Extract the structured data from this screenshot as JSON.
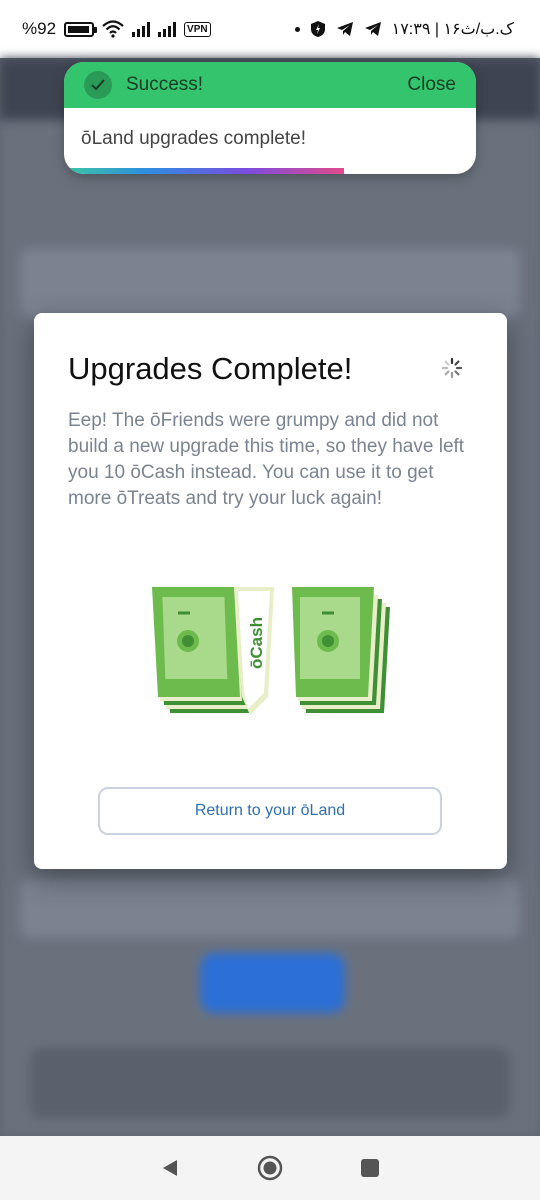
{
  "status_bar": {
    "battery_text": "%92",
    "time_text": "۱۷:۳۹ | ۱۶ک.ب/ث",
    "vpn_label": "VPN"
  },
  "toast": {
    "title": "Success!",
    "close_label": "Close",
    "message": "ōLand upgrades complete!",
    "progress": 0.68
  },
  "modal": {
    "title": "Upgrades Complete!",
    "body": "Eep! The ōFriends were grumpy and did not build a new upgrade this time, so they have left you 10 ōCash instead. You can use it to get more ōTreats and try your luck again!",
    "cash_label": "ōCash",
    "button_label": "Return to your ōLand"
  },
  "colors": {
    "success": "#35c46e",
    "cash_green": "#6dbb4c",
    "button_text": "#2f6fb0"
  },
  "icons": [
    "check-icon",
    "spinner-icon",
    "wifi-icon",
    "battery-icon",
    "back-icon",
    "home-icon",
    "recents-icon",
    "telegram-icon",
    "shield-icon"
  ]
}
